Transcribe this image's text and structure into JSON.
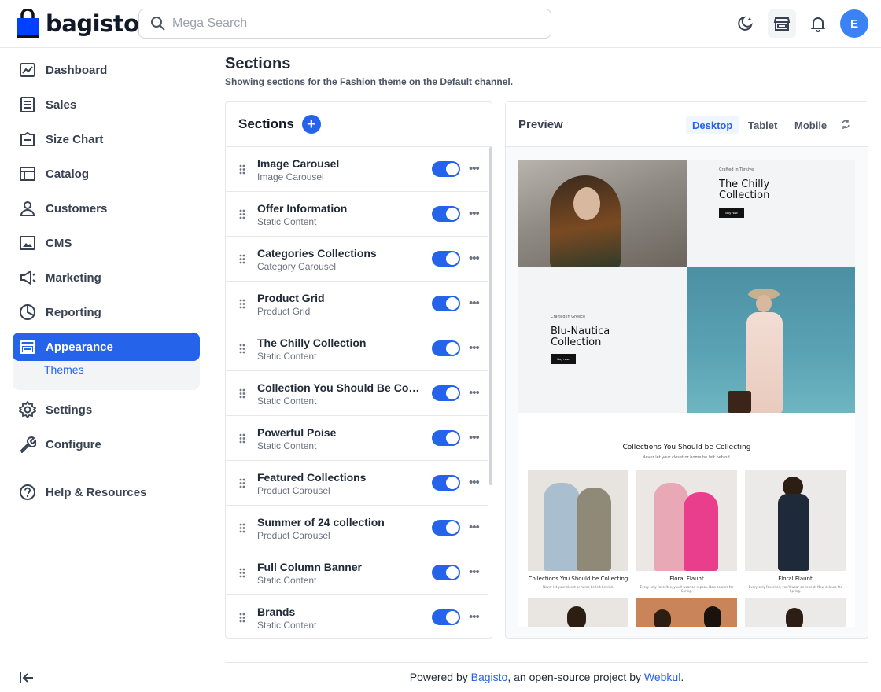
{
  "header": {
    "brand": "bagisto",
    "search_placeholder": "Mega Search",
    "avatar_letter": "E"
  },
  "sidebar": {
    "items": [
      {
        "label": "Dashboard",
        "icon": "dashboard-icon"
      },
      {
        "label": "Sales",
        "icon": "sales-icon"
      },
      {
        "label": "Size Chart",
        "icon": "size-chart-icon"
      },
      {
        "label": "Catalog",
        "icon": "catalog-icon"
      },
      {
        "label": "Customers",
        "icon": "customers-icon"
      },
      {
        "label": "CMS",
        "icon": "cms-icon"
      },
      {
        "label": "Marketing",
        "icon": "marketing-icon"
      },
      {
        "label": "Reporting",
        "icon": "reporting-icon"
      },
      {
        "label": "Appearance",
        "icon": "appearance-icon",
        "active": true
      },
      {
        "label": "Settings",
        "icon": "settings-icon"
      },
      {
        "label": "Configure",
        "icon": "configure-icon"
      },
      {
        "label": "Help & Resources",
        "icon": "help-icon"
      }
    ],
    "sub_item": "Themes"
  },
  "page": {
    "title": "Sections",
    "subtitle": "Showing sections for the Fashion theme on the Default channel."
  },
  "sections_panel": {
    "title": "Sections",
    "add_label": "+",
    "items": [
      {
        "name": "Image Carousel",
        "type": "Image Carousel",
        "enabled": true
      },
      {
        "name": "Offer Information",
        "type": "Static Content",
        "enabled": true
      },
      {
        "name": "Categories Collections",
        "type": "Category Carousel",
        "enabled": true
      },
      {
        "name": "Product Grid",
        "type": "Product Grid",
        "enabled": true
      },
      {
        "name": "The Chilly Collection",
        "type": "Static Content",
        "enabled": true
      },
      {
        "name": "Collection You Should Be Coll...",
        "type": "Static Content",
        "enabled": true
      },
      {
        "name": "Powerful Poise",
        "type": "Static Content",
        "enabled": true
      },
      {
        "name": "Featured Collections",
        "type": "Product Carousel",
        "enabled": true
      },
      {
        "name": "Summer of 24 collection",
        "type": "Product Carousel",
        "enabled": true
      },
      {
        "name": "Full Column Banner",
        "type": "Static Content",
        "enabled": true
      },
      {
        "name": "Brands",
        "type": "Static Content",
        "enabled": true
      }
    ]
  },
  "preview": {
    "title": "Preview",
    "tabs": [
      "Desktop",
      "Tablet",
      "Mobile"
    ],
    "active_tab": "Desktop",
    "content": {
      "tag1": "Crafted in Türkiye",
      "heading1": "The Chilly Collection",
      "tag2": "Crafted in Greece",
      "heading2": "Blu-Nautica Collection",
      "buy_now": "Buy now",
      "collection_title": "Collections You Should be Collecting",
      "collection_sub": "Never let your closet or home be left behind.",
      "products": [
        {
          "name": "Collections You Should be Collecting",
          "desc": "Never let your closet or home be left behind."
        },
        {
          "name": "Floral Flaunt",
          "desc": "Every-only favorites, you'll wear on repeat. New colours for Spring."
        },
        {
          "name": "Floral Flaunt",
          "desc": "Every-only favorites, you'll wear on repeat. New colours for Spring."
        }
      ]
    }
  },
  "footer": {
    "prefix": "Powered by ",
    "link1": "Bagisto",
    "middle": ", an open-source project by ",
    "link2": "Webkul",
    "suffix": "."
  }
}
